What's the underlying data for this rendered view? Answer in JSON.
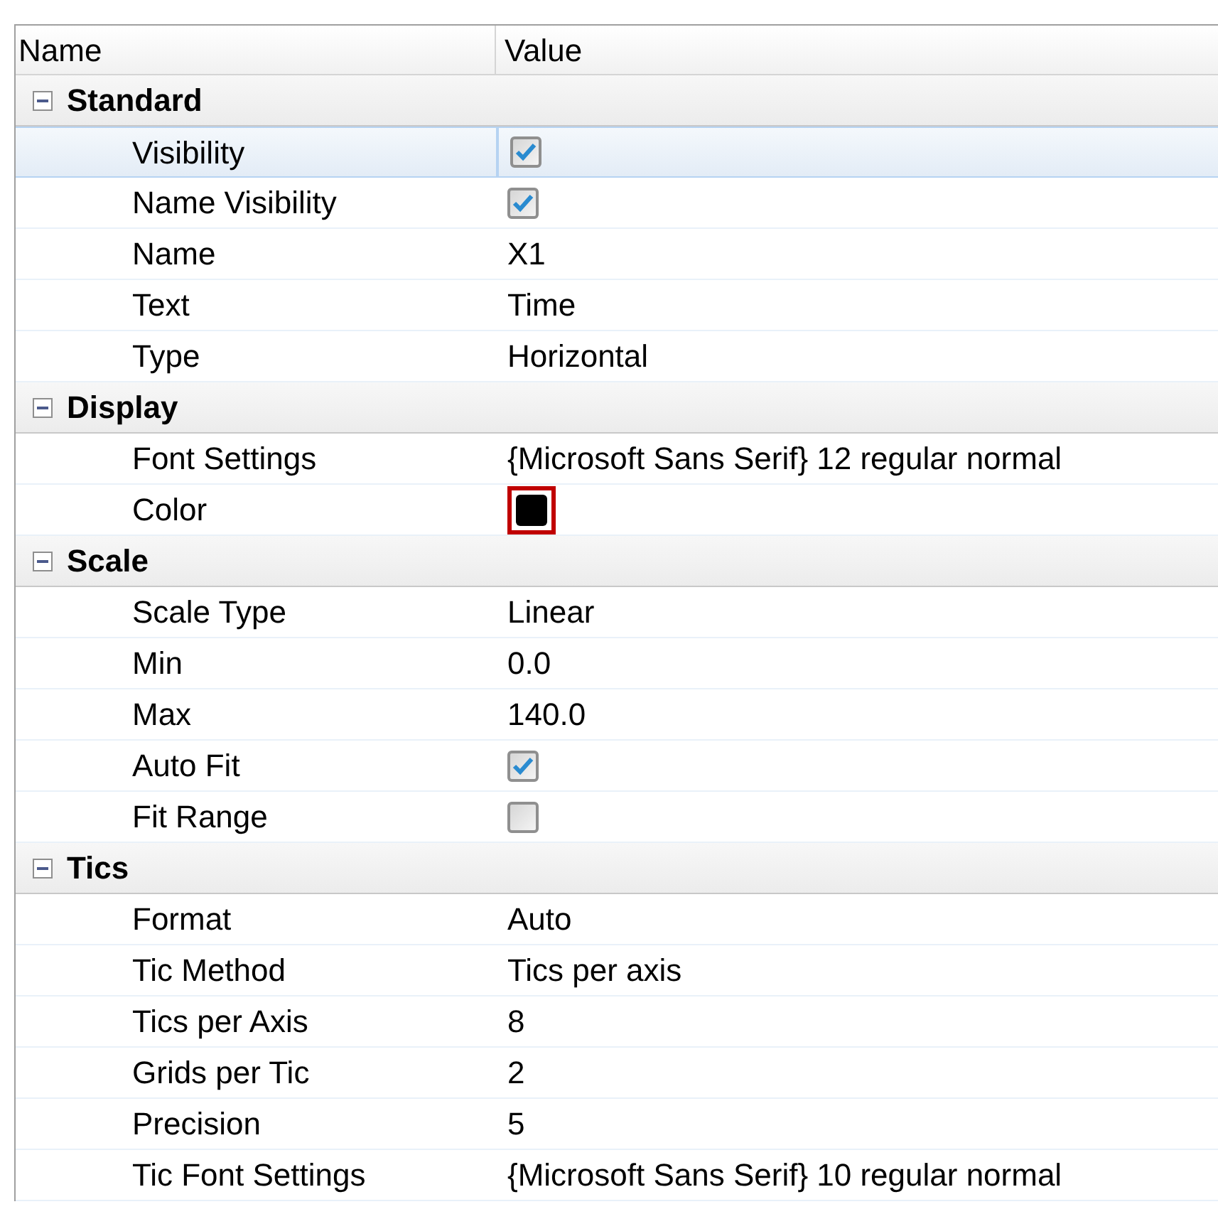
{
  "columns": [
    "Name",
    "Value"
  ],
  "groups": [
    {
      "label": "Standard",
      "expanded": true,
      "properties": [
        {
          "name": "Visibility",
          "kind": "checkbox",
          "checked": true,
          "selected": true
        },
        {
          "name": "Name Visibility",
          "kind": "checkbox",
          "checked": true,
          "selected": false
        },
        {
          "name": "Name",
          "kind": "text",
          "value": "X1",
          "selected": false
        },
        {
          "name": "Text",
          "kind": "text",
          "value": "Time",
          "selected": false
        },
        {
          "name": "Type",
          "kind": "text",
          "value": "Horizontal",
          "selected": false
        }
      ]
    },
    {
      "label": "Display",
      "expanded": true,
      "properties": [
        {
          "name": "Font Settings",
          "kind": "text",
          "value": "{Microsoft Sans Serif} 12 regular normal",
          "selected": false
        },
        {
          "name": "Color",
          "kind": "color",
          "color": "#000000",
          "highlighted": true,
          "selected": false
        }
      ]
    },
    {
      "label": "Scale",
      "expanded": true,
      "properties": [
        {
          "name": "Scale Type",
          "kind": "text",
          "value": "Linear",
          "selected": false
        },
        {
          "name": "Min",
          "kind": "text",
          "value": "0.0",
          "selected": false
        },
        {
          "name": "Max",
          "kind": "text",
          "value": "140.0",
          "selected": false
        },
        {
          "name": "Auto Fit",
          "kind": "checkbox",
          "checked": true,
          "selected": false
        },
        {
          "name": "Fit Range",
          "kind": "checkbox",
          "checked": false,
          "selected": false
        }
      ]
    },
    {
      "label": "Tics",
      "expanded": true,
      "properties": [
        {
          "name": "Format",
          "kind": "text",
          "value": "Auto",
          "selected": false
        },
        {
          "name": "Tic Method",
          "kind": "text",
          "value": "Tics per axis",
          "selected": false
        },
        {
          "name": "Tics per Axis",
          "kind": "text",
          "value": "8",
          "selected": false
        },
        {
          "name": "Grids per Tic",
          "kind": "text",
          "value": "2",
          "selected": false
        },
        {
          "name": "Precision",
          "kind": "text",
          "value": "5",
          "selected": false
        },
        {
          "name": "Tic Font Settings",
          "kind": "text",
          "value": "{Microsoft Sans Serif} 10 regular normal",
          "selected": false
        }
      ]
    }
  ]
}
